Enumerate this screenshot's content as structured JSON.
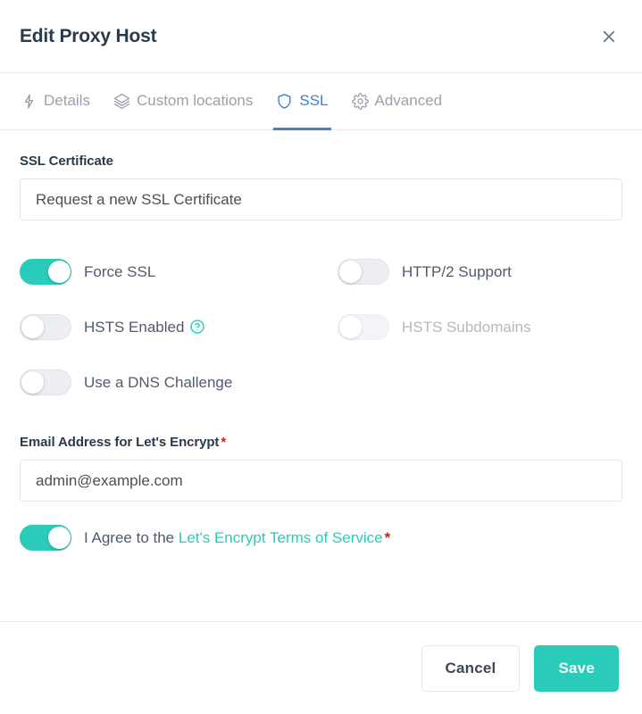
{
  "header": {
    "title": "Edit Proxy Host",
    "close_icon": "close-icon"
  },
  "tabs": [
    {
      "label": "Details",
      "icon": "bolt-icon",
      "active": false
    },
    {
      "label": "Custom locations",
      "icon": "layers-icon",
      "active": false
    },
    {
      "label": "SSL",
      "icon": "shield-icon",
      "active": true
    },
    {
      "label": "Advanced",
      "icon": "gear-icon",
      "active": false
    }
  ],
  "ssl_certificate": {
    "label": "SSL Certificate",
    "value": "Request a new SSL Certificate"
  },
  "toggles": [
    {
      "label": "Force SSL",
      "state": "on",
      "disabled": false,
      "help": false
    },
    {
      "label": "HTTP/2 Support",
      "state": "off",
      "disabled": false,
      "help": false
    },
    {
      "label": "HSTS Enabled",
      "state": "off",
      "disabled": false,
      "help": true,
      "help_icon": "question-circle-icon"
    },
    {
      "label": "HSTS Subdomains",
      "state": "off",
      "disabled": true,
      "help": false
    },
    {
      "label": "Use a DNS Challenge",
      "state": "off",
      "disabled": false,
      "help": false
    }
  ],
  "email": {
    "label": "Email Address for Let's Encrypt",
    "required_marker": "*",
    "value": "admin@example.com"
  },
  "agreement": {
    "state": "on",
    "prefix": "I Agree to the ",
    "link_text": "Let's Encrypt Terms of Service",
    "required_marker": "*"
  },
  "footer": {
    "cancel_label": "Cancel",
    "save_label": "Save"
  },
  "colors": {
    "teal": "#2bcbba",
    "blue": "#467fcf",
    "red": "#cd201f",
    "text_dark": "#2b3a4a",
    "text_body": "#4f5b6d",
    "text_muted": "#9aa0ac",
    "border": "#e9ecf1"
  }
}
